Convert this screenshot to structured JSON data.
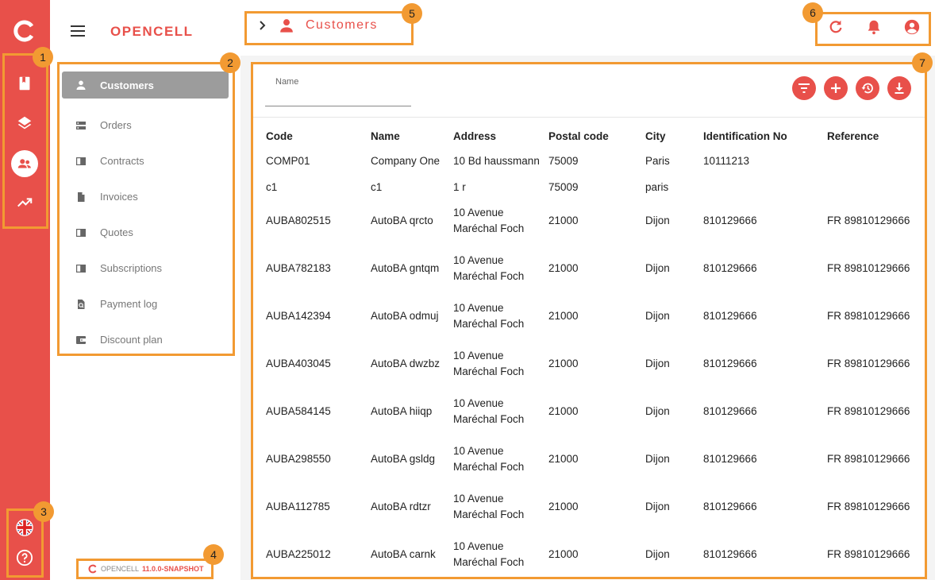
{
  "app": {
    "brand": "OPENCELL",
    "version_prefix": "OPENCELL",
    "version": "11.0.0-SNAPSHOT"
  },
  "breadcrumb": {
    "title": "Customers"
  },
  "menu": {
    "items": [
      {
        "label": "Customers"
      },
      {
        "label": "Orders"
      },
      {
        "label": "Contracts"
      },
      {
        "label": "Invoices"
      },
      {
        "label": "Quotes"
      },
      {
        "label": "Subscriptions"
      },
      {
        "label": "Payment log"
      },
      {
        "label": "Discount plan"
      }
    ]
  },
  "search": {
    "label": "Name",
    "value": ""
  },
  "table": {
    "columns": [
      "Code",
      "Name",
      "Address",
      "Postal code",
      "City",
      "Identification No",
      "Reference"
    ],
    "rows": [
      [
        "COMP01",
        "Company One",
        "10 Bd haussmann",
        "75009",
        "Paris",
        "10111213",
        ""
      ],
      [
        "c1",
        "c1",
        "1 r",
        "75009",
        "paris",
        "",
        ""
      ],
      [
        "AUBA802515",
        "AutoBA qrcto",
        "10 Avenue Maréchal Foch",
        "21000",
        "Dijon",
        "810129666",
        "FR 89810129666"
      ],
      [
        "AUBA782183",
        "AutoBA gntqm",
        "10 Avenue Maréchal Foch",
        "21000",
        "Dijon",
        "810129666",
        "FR 89810129666"
      ],
      [
        "AUBA142394",
        "AutoBA odmuj",
        "10 Avenue Maréchal Foch",
        "21000",
        "Dijon",
        "810129666",
        "FR 89810129666"
      ],
      [
        "AUBA403045",
        "AutoBA dwzbz",
        "10 Avenue Maréchal Foch",
        "21000",
        "Dijon",
        "810129666",
        "FR 89810129666"
      ],
      [
        "AUBA584145",
        "AutoBA hiiqp",
        "10 Avenue Maréchal Foch",
        "21000",
        "Dijon",
        "810129666",
        "FR 89810129666"
      ],
      [
        "AUBA298550",
        "AutoBA gsldg",
        "10 Avenue Maréchal Foch",
        "21000",
        "Dijon",
        "810129666",
        "FR 89810129666"
      ],
      [
        "AUBA112785",
        "AutoBA rdtzr",
        "10 Avenue Maréchal Foch",
        "21000",
        "Dijon",
        "810129666",
        "FR 89810129666"
      ],
      [
        "AUBA225012",
        "AutoBA carnk",
        "10 Avenue Maréchal Foch",
        "21000",
        "Dijon",
        "810129666",
        "FR 89810129666"
      ]
    ]
  },
  "annotations": [
    "1",
    "2",
    "3",
    "4",
    "5",
    "6",
    "7"
  ],
  "colors": {
    "accent": "#e8504a",
    "annotation": "#f29a32",
    "active_menu": "#9c9c9c"
  }
}
